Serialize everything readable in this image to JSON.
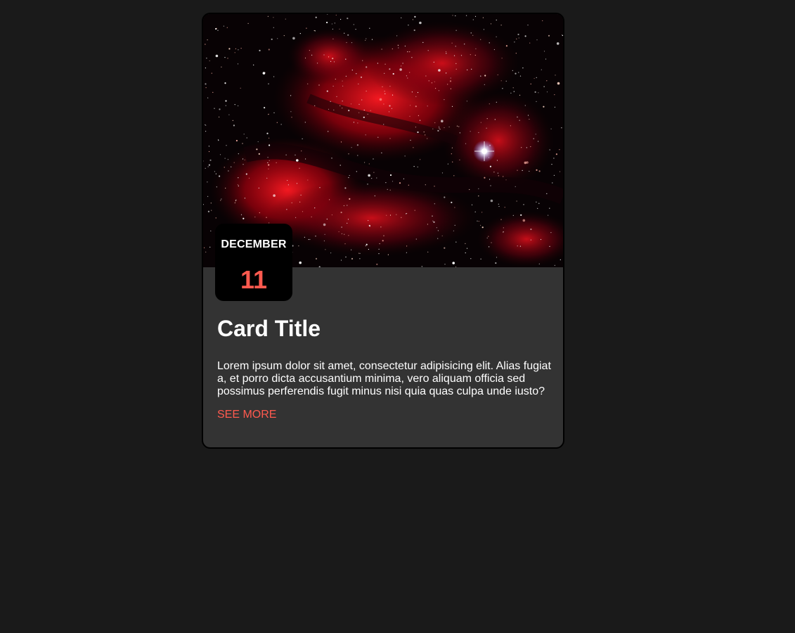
{
  "card": {
    "image_alt": "Red nebula star field",
    "date_month": "DECEMBER",
    "date_day": "11",
    "title": "Card Title",
    "text": "Lorem ipsum dolor sit amet, consectetur adipisicing elit. Alias fugiat a, et porro dicta accusantium minima, vero aliquam officia sed possimus perferendis fugit minus nisi quia quas culpa unde iusto?",
    "link_label": "SEE MORE"
  },
  "colors": {
    "page_background": "#1a1a1a",
    "card_background": "#333333",
    "badge_background": "#000000",
    "accent": "#ff5a4f",
    "text": "#ffffff"
  }
}
